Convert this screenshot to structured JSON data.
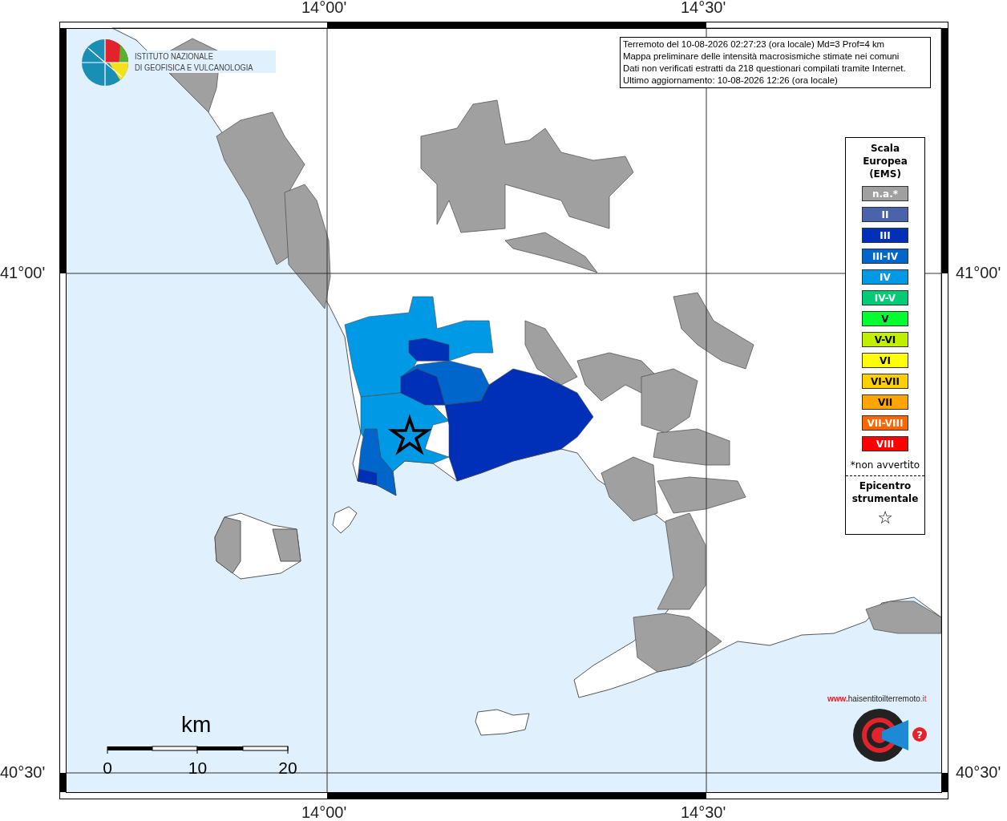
{
  "axes": {
    "top": [
      "14°00'",
      "14°30'"
    ],
    "left": [
      "41°00'",
      "40°30'"
    ],
    "right": [
      "41°00'",
      "40°30'"
    ],
    "bottom": [
      "14°00'",
      "14°30'"
    ]
  },
  "institute_logo": {
    "lines": [
      "ISTITUTO NAZIONALE",
      "DI GEOFISICA E VULCANOLOGIA"
    ]
  },
  "info_box": [
    "Terremoto del 10-08-2026 02:27:23 (ora locale) Md=3 Prof=4 km",
    "Mappa preliminare delle intensità macrosismiche stimate nei comuni",
    "Dati non verificati estratti da 218 questionari compilati tramite Internet.",
    "Ultimo aggiornamento: 10-08-2026 12:26 (ora locale)"
  ],
  "legend": {
    "title": [
      "Scala",
      "Europea",
      "(EMS)"
    ],
    "items": [
      {
        "label": "n.a.*",
        "color": "#a0a0a0"
      },
      {
        "label": "II",
        "color": "#4a63ab"
      },
      {
        "label": "III",
        "color": "#0030b8"
      },
      {
        "label": "III-IV",
        "color": "#0066cc"
      },
      {
        "label": "IV",
        "color": "#0099e6"
      },
      {
        "label": "IV-V",
        "color": "#00cc77"
      },
      {
        "label": "V",
        "color": "#00ff30"
      },
      {
        "label": "V-VI",
        "color": "#c0f000"
      },
      {
        "label": "VI",
        "color": "#ffff00"
      },
      {
        "label": "VI-VII",
        "color": "#ffd000"
      },
      {
        "label": "VII",
        "color": "#ffa500"
      },
      {
        "label": "VII-VIII",
        "color": "#ff6600"
      },
      {
        "label": "VIII",
        "color": "#ff0000"
      }
    ],
    "note": "*non avvertito",
    "epicenter_title": [
      "Epicentro",
      "strumentale"
    ],
    "epicenter_symbol": "☆"
  },
  "scale_bar": {
    "unit": "km",
    "ticks": [
      "0",
      "10",
      "20"
    ]
  },
  "site_logo": {
    "prefix": "www.",
    "name": "haisentitoilterremoto",
    ".suffix": ".it",
    "badge": "?"
  }
}
